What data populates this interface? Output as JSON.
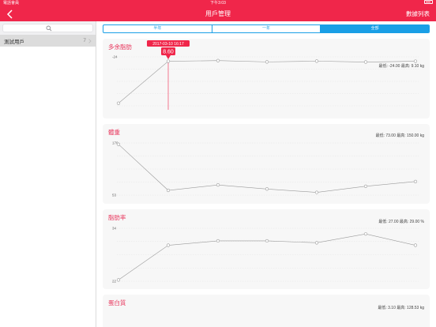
{
  "status": {
    "carrier": "電話會員",
    "time": "下午3:03"
  },
  "nav": {
    "title": "用戶管理",
    "action": "數據列表"
  },
  "sidebar": {
    "users": [
      {
        "name": "測試用戶",
        "count": "7"
      }
    ]
  },
  "segments": [
    {
      "label": "半年",
      "active": false
    },
    {
      "label": "一年",
      "active": false
    },
    {
      "label": "全部",
      "active": true
    }
  ],
  "colors": {
    "accent": "#f0264a",
    "segment": "#1a9fe6",
    "title": "#e8375d"
  },
  "charts": [
    {
      "title": "多余脂肪",
      "range_text": "最低: -24.00  最高: 9.10 kg",
      "ytick_labels": [
        "-24"
      ],
      "tooltip": {
        "date": "2017-03-10 16:17",
        "value": "8.60"
      },
      "values": [
        -24.0,
        8.6,
        9.1,
        8.1,
        8.7,
        8.0,
        8.6
      ]
    },
    {
      "title": "體重",
      "range_text": "最低: 73.00  最高: 150.00 kg",
      "ytick_labels": [
        "170",
        "53"
      ],
      "values": [
        148,
        80,
        88,
        82,
        77,
        86,
        93
      ]
    },
    {
      "title": "脂肪率",
      "range_text": "最低: 27.00  最高: 29.00 %",
      "ytick_labels": [
        "34",
        "22"
      ],
      "values": [
        21.7,
        27.2,
        27.9,
        27.9,
        27.6,
        29.0,
        27.2
      ]
    },
    {
      "title": "蛋白質",
      "range_text": "最低: 3.10  最高: 128.53 kg",
      "ytick_labels": [],
      "values": []
    }
  ]
}
